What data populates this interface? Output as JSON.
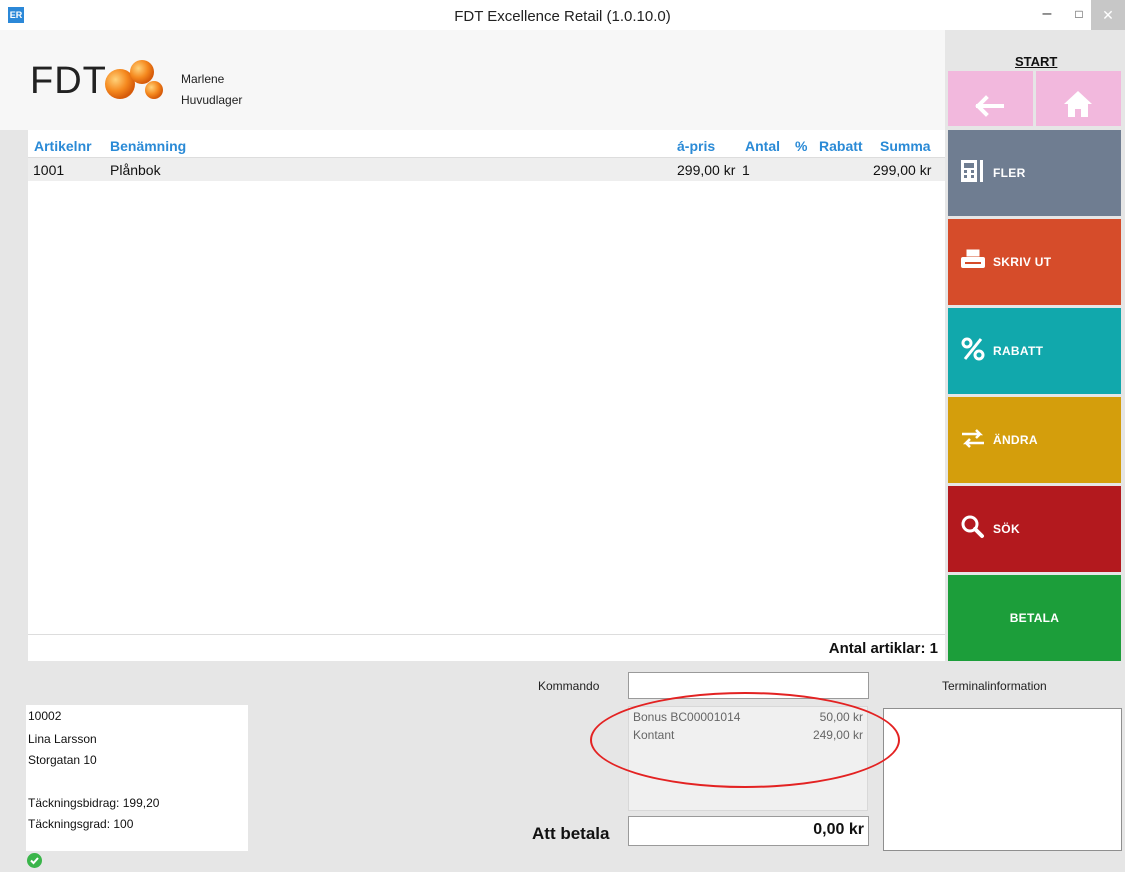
{
  "window": {
    "app_icon_text": "ER",
    "title": "FDT Excellence Retail (1.0.10.0)",
    "minimize": "–",
    "maximize": "□",
    "close": "✕"
  },
  "header": {
    "logo_text": "FDT",
    "user_name": "Marlene",
    "store_name": "Huvudlager"
  },
  "table": {
    "columns": {
      "artikelnr": "Artikelnr",
      "benamning": "Benämning",
      "apris": "á-pris",
      "antal": "Antal",
      "procent": "%",
      "rabatt": "Rabatt",
      "summa": "Summa"
    },
    "rows": [
      {
        "artikelnr": "1001",
        "benamning": "Plånbok",
        "apris": "299,00 kr",
        "antal": "1",
        "procent": "",
        "rabatt": "",
        "summa": "299,00 kr"
      }
    ],
    "item_count_label": "Antal artiklar: 1"
  },
  "right_panel": {
    "start_label": "START",
    "back_icon": "arrow-left-icon",
    "home_icon": "home-icon",
    "tiles": [
      {
        "label": "FLER",
        "icon": "calculator-icon",
        "color": "#6f7d91"
      },
      {
        "label": "SKRIV UT",
        "icon": "printer-icon",
        "color": "#d64c2a"
      },
      {
        "label": "RABATT",
        "icon": "percent-icon",
        "color": "#11a8ac"
      },
      {
        "label": "ÄNDRA",
        "icon": "swap-arrows-icon",
        "color": "#d49e0c"
      },
      {
        "label": "SÖK",
        "icon": "magnifier-icon",
        "color": "#b3191e"
      },
      {
        "label": "BETALA",
        "icon": "",
        "color": "#1c9e3a"
      }
    ],
    "nav_color": "#f2b8dd"
  },
  "customer": {
    "id": "10002",
    "name": "Lina Larsson",
    "address": "Storgatan 10",
    "tackningsbidrag": "Täckningsbidrag: 199,20",
    "tackningsgrad": "Täckningsgrad: 100"
  },
  "command": {
    "label": "Kommando",
    "value": ""
  },
  "terminal": {
    "label": "Terminalinformation"
  },
  "payments": [
    {
      "method": "Bonus BC00001014",
      "amount": "50,00 kr"
    },
    {
      "method": "Kontant",
      "amount": "249,00 kr"
    }
  ],
  "total": {
    "label": "Att betala",
    "amount": "0,00 kr"
  },
  "accent_color": "#2a8ad6"
}
